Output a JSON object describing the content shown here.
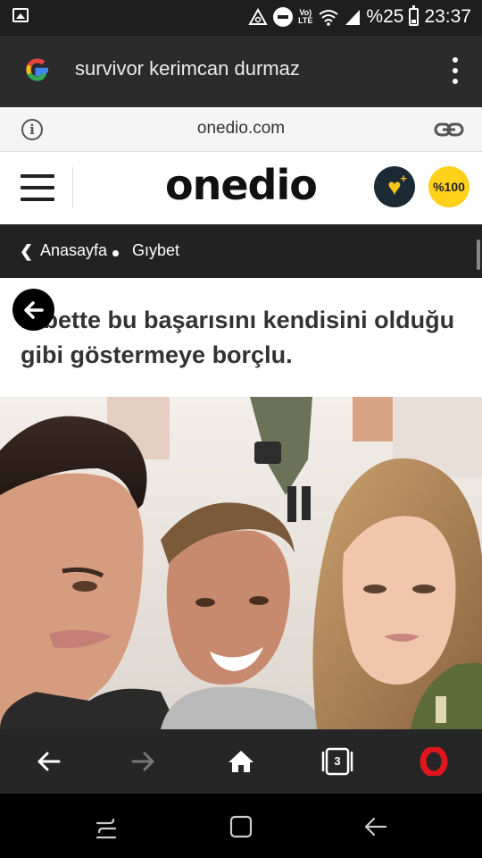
{
  "status_bar": {
    "battery_percent": "%25",
    "time": "23:37",
    "volte_label": "Vo)\nLTE",
    "icons": [
      "image-icon",
      "alarm-icon",
      "dnd-icon",
      "volte-icon",
      "wifi-icon",
      "signal-icon",
      "battery-icon"
    ]
  },
  "browser": {
    "search_query": "survivor kerimcan durmaz",
    "domain": "onedio.com"
  },
  "site": {
    "logo": "onedio",
    "score_badge": "%100"
  },
  "breadcrumb": {
    "home": "Anasayfa",
    "category": "Gıybet"
  },
  "article": {
    "text": "Elbette bu başarısını kendisini olduğu gibi göstermeye borçlu."
  },
  "bottom_nav": {
    "tabs_count": "3"
  },
  "colors": {
    "brand_yellow": "#ffd11a",
    "opera_red": "#e0161e",
    "breadcrumb_bg": "#222222"
  }
}
